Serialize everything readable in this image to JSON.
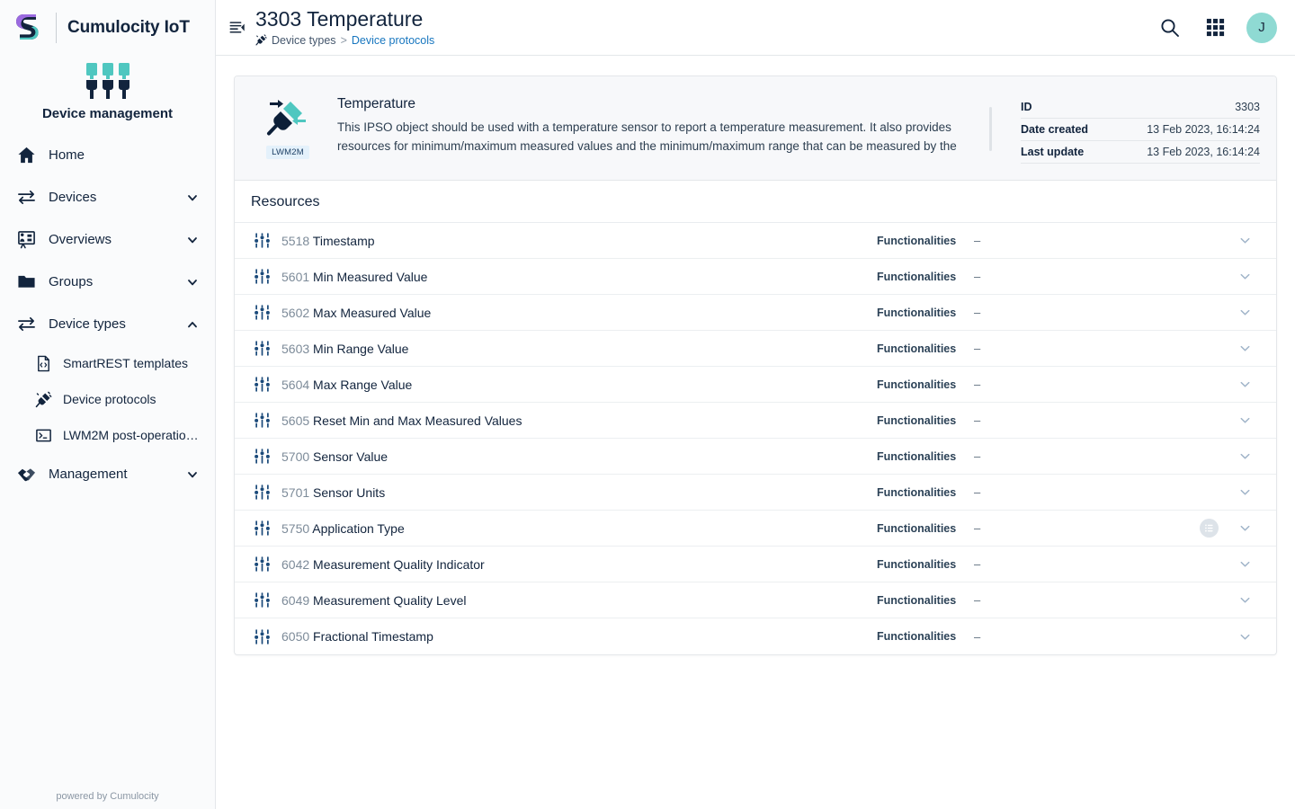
{
  "brand": {
    "name": "Cumulocity IoT",
    "app_title": "Device management",
    "logo_icon": "cumulocity-s-logo",
    "app_icon": "device-management-icon",
    "footer": "powered by Cumulocity"
  },
  "sidebar": {
    "items": [
      {
        "label": "Home",
        "icon": "home-icon",
        "expandable": false
      },
      {
        "label": "Devices",
        "icon": "transfer-icon",
        "expandable": true,
        "expanded": false
      },
      {
        "label": "Overviews",
        "icon": "presentation-icon",
        "expandable": true,
        "expanded": false
      },
      {
        "label": "Groups",
        "icon": "folder-icon",
        "expandable": true,
        "expanded": false
      },
      {
        "label": "Device types",
        "icon": "transfer-icon",
        "expandable": true,
        "expanded": true
      },
      {
        "label": "Management",
        "icon": "handshake-icon",
        "expandable": true,
        "expanded": false
      }
    ],
    "sub_items": [
      {
        "label": "SmartREST templates",
        "icon": "code-file-icon"
      },
      {
        "label": "Device protocols",
        "icon": "plug-icon"
      },
      {
        "label": "LWM2M post-operatio…",
        "icon": "terminal-icon"
      }
    ]
  },
  "topbar": {
    "collapse_icon": "collapse-sidebar-icon",
    "title": "3303 Temperature",
    "breadcrumb": {
      "icon": "plug-icon",
      "root": "Device types",
      "separator": ">",
      "current": "Device protocols"
    },
    "search_icon": "search-icon",
    "apps_icon": "app-grid-icon",
    "avatar_initial": "J"
  },
  "info": {
    "icon": "lwm2m-plug-icon",
    "badge": "LWM2M",
    "name": "Temperature",
    "description": "This IPSO object should be used with a temperature sensor to report a temperature measurement.  It also provides resources for minimum/maximum measured values and the minimum/maximum range that can be measured by the",
    "meta": [
      {
        "key": "ID",
        "value": "3303"
      },
      {
        "key": "Date created",
        "value": "13 Feb 2023, 16:14:24"
      },
      {
        "key": "Last update",
        "value": "13 Feb 2023, 16:14:24"
      }
    ]
  },
  "resources": {
    "header": "Resources",
    "functionalities_label": "Functionalities",
    "empty_value": "–",
    "row_icon": "sliders-icon",
    "expand_icon": "chevron-down-icon",
    "list_icon": "list-circle-icon",
    "items": [
      {
        "id": "5518",
        "name": "Timestamp",
        "functionalities": "Functionalities",
        "value": "–",
        "has_list_icon": false
      },
      {
        "id": "5601",
        "name": "Min Measured Value",
        "functionalities": "Functionalities",
        "value": "–",
        "has_list_icon": false
      },
      {
        "id": "5602",
        "name": "Max Measured Value",
        "functionalities": "Functionalities",
        "value": "–",
        "has_list_icon": false
      },
      {
        "id": "5603",
        "name": "Min Range Value",
        "functionalities": "Functionalities",
        "value": "–",
        "has_list_icon": false
      },
      {
        "id": "5604",
        "name": "Max Range Value",
        "functionalities": "Functionalities",
        "value": "–",
        "has_list_icon": false
      },
      {
        "id": "5605",
        "name": "Reset Min and Max Measured Values",
        "functionalities": "Functionalities",
        "value": "–",
        "has_list_icon": false
      },
      {
        "id": "5700",
        "name": "Sensor Value",
        "functionalities": "Functionalities",
        "value": "–",
        "has_list_icon": false
      },
      {
        "id": "5701",
        "name": "Sensor Units",
        "functionalities": "Functionalities",
        "value": "–",
        "has_list_icon": false
      },
      {
        "id": "5750",
        "name": "Application Type",
        "functionalities": "Functionalities",
        "value": "–",
        "has_list_icon": true
      },
      {
        "id": "6042",
        "name": "Measurement Quality Indicator",
        "functionalities": "Functionalities",
        "value": "–",
        "has_list_icon": false
      },
      {
        "id": "6049",
        "name": "Measurement Quality Level",
        "functionalities": "Functionalities",
        "value": "–",
        "has_list_icon": false
      },
      {
        "id": "6050",
        "name": "Fractional Timestamp",
        "functionalities": "Functionalities",
        "value": "–",
        "has_list_icon": false
      }
    ]
  },
  "colors": {
    "brand_dark": "#12243d",
    "accent_teal": "#54c8bd",
    "link_blue": "#1776bf",
    "avatar_bg": "#8fdad3",
    "sidebar_bg": "#fafbfc",
    "panel_bg": "#f7f8fa",
    "border": "#e4e7ea"
  }
}
